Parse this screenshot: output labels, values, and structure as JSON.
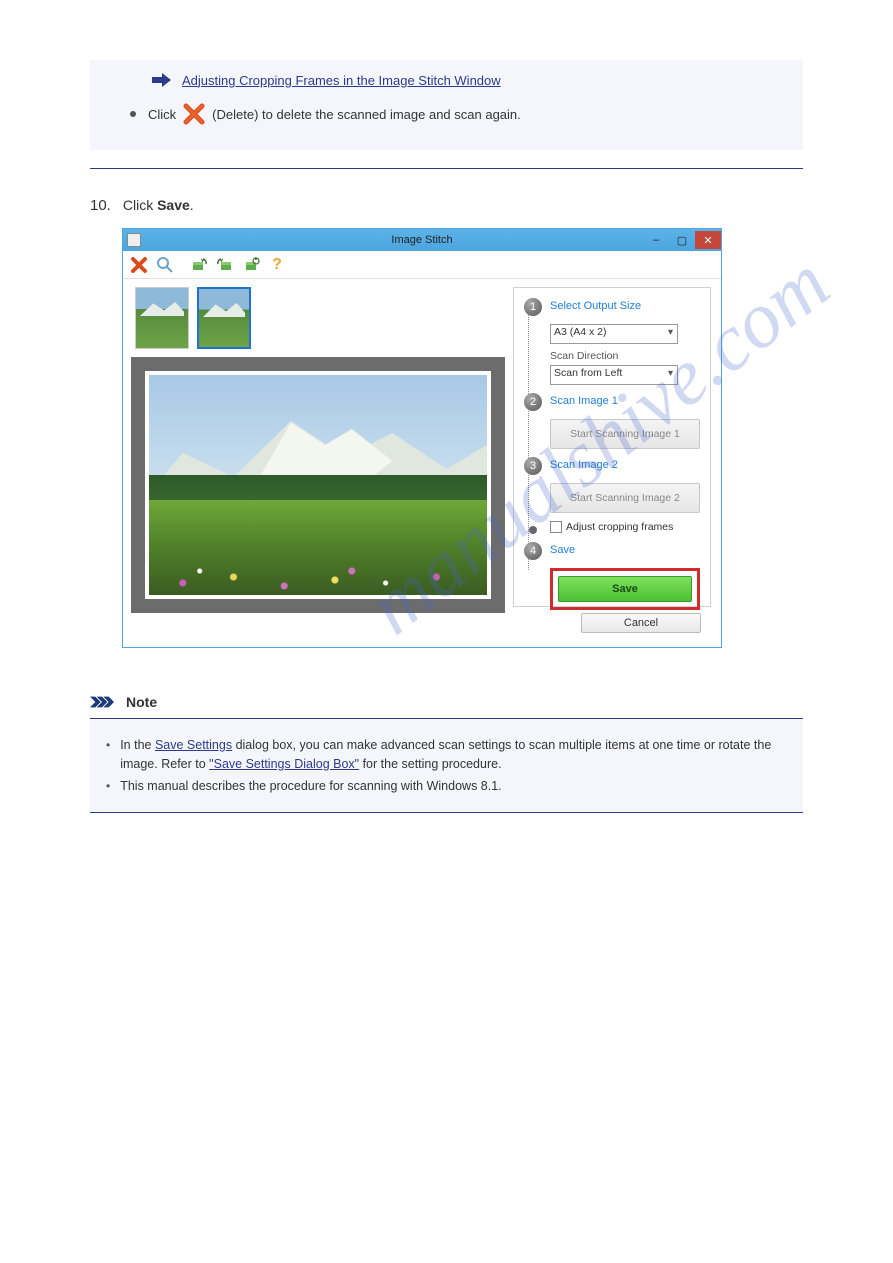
{
  "top_note": {
    "link": "Adjusting Cropping Frames in the Image Stitch Window",
    "x_line_before": "Click",
    "x_line_after": "(Delete) to delete the scanned image and scan again."
  },
  "step": {
    "number": "10.",
    "text": "Click Save."
  },
  "window": {
    "title": "Image Stitch",
    "controls": {
      "min": "–",
      "max": "▢",
      "close": "✕"
    },
    "toolbar": {
      "delete": "✕",
      "zoom": "🔍",
      "rotate_left": "↶",
      "rotate_right": "↷",
      "rotate_all": "⟳",
      "help": "?"
    },
    "steps": {
      "s1": {
        "num": "1",
        "title": "Select Output Size",
        "size_value": "A3 (A4 x 2)",
        "direction_label": "Scan Direction",
        "direction_value": "Scan from Left"
      },
      "s2": {
        "num": "2",
        "title": "Scan Image 1",
        "button": "Start Scanning Image 1"
      },
      "s3": {
        "num": "3",
        "title": "Scan Image 2",
        "button": "Start Scanning Image 2"
      },
      "crop": {
        "label": "Adjust cropping frames"
      },
      "s4": {
        "num": "4",
        "title": "Save",
        "button": "Save"
      }
    },
    "cancel": "Cancel"
  },
  "bottom_note": {
    "header": "Note",
    "item1a": "In the ",
    "item1b": "Save Settings",
    "item1c": " dialog box, you can make advanced scan settings to scan multiple items at one time or rotate the image.",
    "item1d": " \"Save Settings Dialog Box\"",
    "item1e": " for the setting procedure.",
    "item1_refer": "Refer to",
    "item2": "This manual describes the procedure for scanning with Windows 8.1."
  }
}
